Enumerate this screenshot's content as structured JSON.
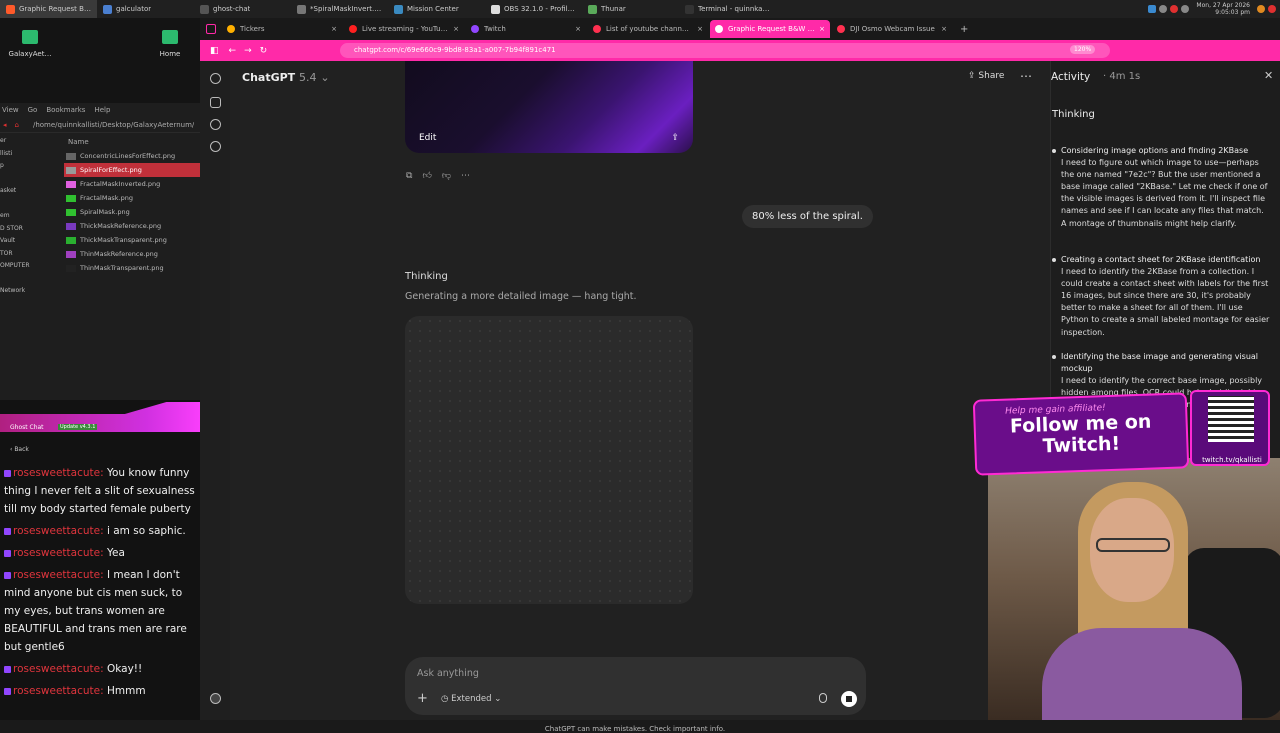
{
  "taskbar": {
    "items": [
      {
        "label": "Graphic Request B&W S…",
        "color": "#ff5a2a",
        "active": true
      },
      {
        "label": "galculator",
        "color": "#4a7fd0",
        "active": false
      },
      {
        "label": "ghost-chat",
        "color": "#555555",
        "active": false
      },
      {
        "label": "*SpiralMaskInvert.xcf-1…",
        "color": "#777777",
        "active": false
      },
      {
        "label": "Mission Center",
        "color": "#3a8ac0",
        "active": false
      },
      {
        "label": "OBS 32.1.0 - Profile: Unt…",
        "color": "#dddddd",
        "active": false
      },
      {
        "label": "Thunar",
        "color": "#5aaa5a",
        "active": false
      },
      {
        "label": "Terminal - quinnkallisti@…",
        "color": "#333333",
        "active": false
      }
    ],
    "clock_time": "9:05:03 pm",
    "clock_date": "Mon, 27 Apr 2026"
  },
  "desktop": {
    "icons": [
      {
        "label": "GalaxyAet…"
      },
      {
        "label": "Home"
      }
    ]
  },
  "file_manager": {
    "menu": [
      "View",
      "Go",
      "Bookmarks",
      "Help"
    ],
    "path": "/home/quinnkallisti/Desktop/GalaxyAeternum/",
    "column_header": "Name",
    "sidebar": [
      "er",
      "llisti",
      "p",
      "",
      "asket",
      "",
      "em",
      "D STOR",
      "Vault",
      "TOR",
      "OMPUTER",
      "",
      "Network"
    ],
    "files": [
      {
        "name": "ConcentricLinesForEffect.png",
        "color": "#666666"
      },
      {
        "name": "SpiralForEffect.png",
        "color": "#999999",
        "selected": true
      },
      {
        "name": "FractalMaskInverted.png",
        "color": "#e060e0"
      },
      {
        "name": "FractalMask.png",
        "color": "#30c030"
      },
      {
        "name": "SpiralMask.png",
        "color": "#30c030"
      },
      {
        "name": "ThickMaskReference.png",
        "color": "#7a3ac0"
      },
      {
        "name": "ThickMaskTransparent.png",
        "color": "#2ab030"
      },
      {
        "name": "ThinMaskReference.png",
        "color": "#a040c0"
      },
      {
        "name": "ThinMaskTransparent.png",
        "color": "#222222"
      }
    ]
  },
  "chat_overlay": {
    "title": "Ghost Chat",
    "update": "Update v4.3.1",
    "back": "Back",
    "messages": [
      {
        "user": "rosesweettacute:",
        "text": "You know funny thing I never felt a slit of sexualness till my body started female puberty"
      },
      {
        "user": "rosesweettacute:",
        "text": "i am so saphic."
      },
      {
        "user": "rosesweettacute:",
        "text": "Yea"
      },
      {
        "user": "rosesweettacute:",
        "text": "I mean I don't mind anyone but cis men suck, to my eyes, but trans women are BEAUTIFUL and trans men are rare but gentle6"
      },
      {
        "user": "rosesweettacute:",
        "text": "Okay!!"
      },
      {
        "user": "rosesweettacute:",
        "text": "Hmmm"
      }
    ]
  },
  "browser": {
    "tabs": [
      {
        "label": "Tickers",
        "color": "#ffb000",
        "active": false
      },
      {
        "label": "Live streaming - YouTube S",
        "color": "#ff2020",
        "active": false
      },
      {
        "label": "Twitch",
        "color": "#9146ff",
        "active": false
      },
      {
        "label": "List of youtube channels o",
        "color": "#ff3050",
        "active": false
      },
      {
        "label": "Graphic Request B&W Spi",
        "color": "#ffffff",
        "active": true
      },
      {
        "label": "DJI Osmo Webcam Issue",
        "color": "#ff3050",
        "active": false
      }
    ],
    "url": "chatgpt.com/c/69e660c9-9bd8-83a1-a007-7b94f891c471",
    "zoom": "120%"
  },
  "chatgpt": {
    "model": "ChatGPT",
    "version": "5.4",
    "share_label": "Share",
    "edit_label": "Edit",
    "user_message": "80% less of the spiral.",
    "thinking_label": "Thinking",
    "generating_label": "Generating a more detailed image — hang tight.",
    "composer_placeholder": "Ask anything",
    "extended_label": "Extended",
    "disclaimer": "ChatGPT can make mistakes. Check important info."
  },
  "activity": {
    "title": "Activity",
    "time": "4m 1s",
    "section": "Thinking",
    "steps": [
      {
        "heading": "Considering image options and finding 2KBase",
        "body": "I need to figure out which image to use—perhaps the one named \"7e2c\"? But the user mentioned a base image called \"2KBase.\" Let me check if one of the visible images is derived from it. I'll inspect file names and see if I can locate any files that match. A montage of thumbnails might help clarify."
      },
      {
        "heading": "Creating a contact sheet for 2KBase identification",
        "body": "I need to identify the 2KBase from a collection. I could create a contact sheet with labels for the first 16 images, but since there are 30, it's probably better to make a sheet for all of them. I'll use Python to create a small labeled montage for easier inspection."
      },
      {
        "heading": "Identifying the base image and generating visual mockup",
        "body": "I need to identify the correct base image, possibly hidden among files. OCR could help, but it might not be the easiest approach. It might be … using image similarity metho…"
      }
    ]
  },
  "overlay": {
    "small_text": "Help me gain affiliate!",
    "big_text": "Follow me on Twitch!",
    "qr_url": "twitch.tv/qkallisti"
  }
}
